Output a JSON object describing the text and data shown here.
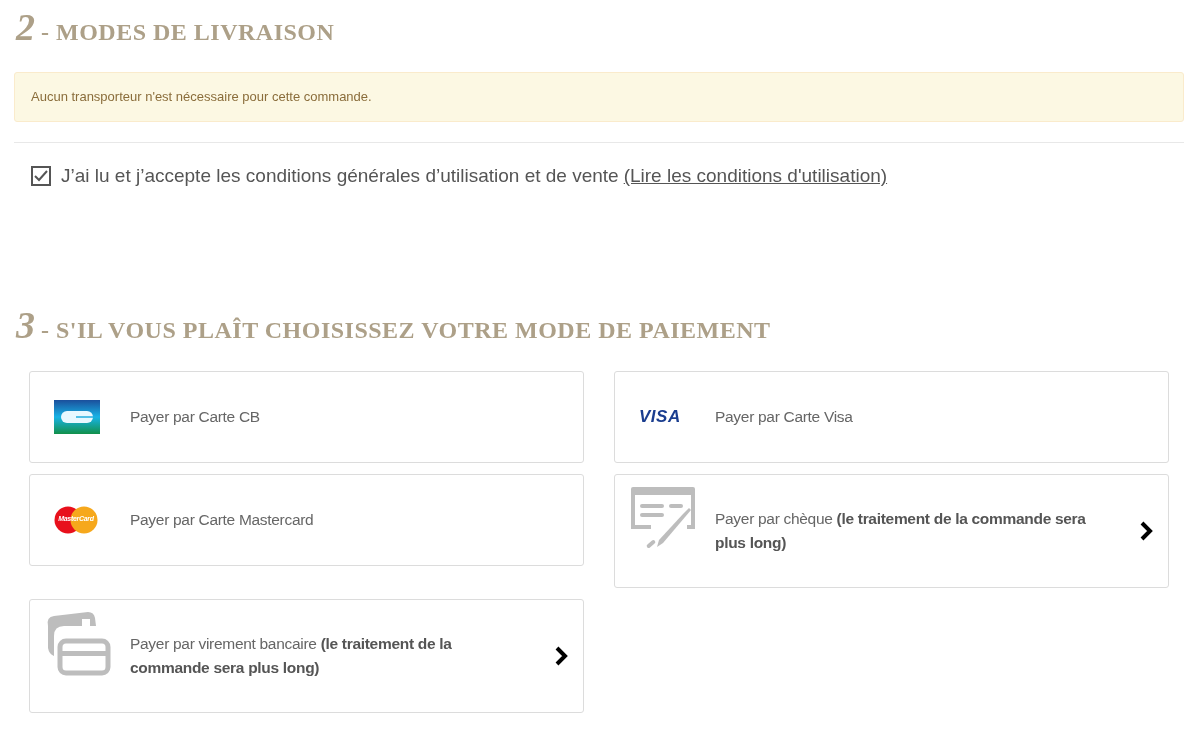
{
  "delivery": {
    "number": "2",
    "title": "- MODES DE LIVRAISON",
    "alert": "Aucun transporteur n'est nécessaire pour cette commande.",
    "terms": {
      "checked": true,
      "label": "J’ai lu et j’accepte les conditions générales d’utilisation et de vente",
      "link": "(Lire les conditions d'utilisation)"
    }
  },
  "payment": {
    "number": "3",
    "title": "- S'IL VOUS PLAÎT CHOISISSEZ VOTRE MODE DE PAIEMENT",
    "options": [
      {
        "kind": "cb",
        "label": "Payer par Carte CB"
      },
      {
        "kind": "visa",
        "logo_text": "VISA",
        "label": "Payer par Carte Visa"
      },
      {
        "kind": "mastercard",
        "logo_text": "MasterCard",
        "label": "Payer par Carte Mastercard"
      },
      {
        "kind": "cheque",
        "label": "Payer par chèque **(le traitement de la commande sera plus long)**"
      },
      {
        "kind": "transfer",
        "label": "Payer par virement bancaire **(le traitement de la commande sera plus long)**"
      }
    ]
  }
}
